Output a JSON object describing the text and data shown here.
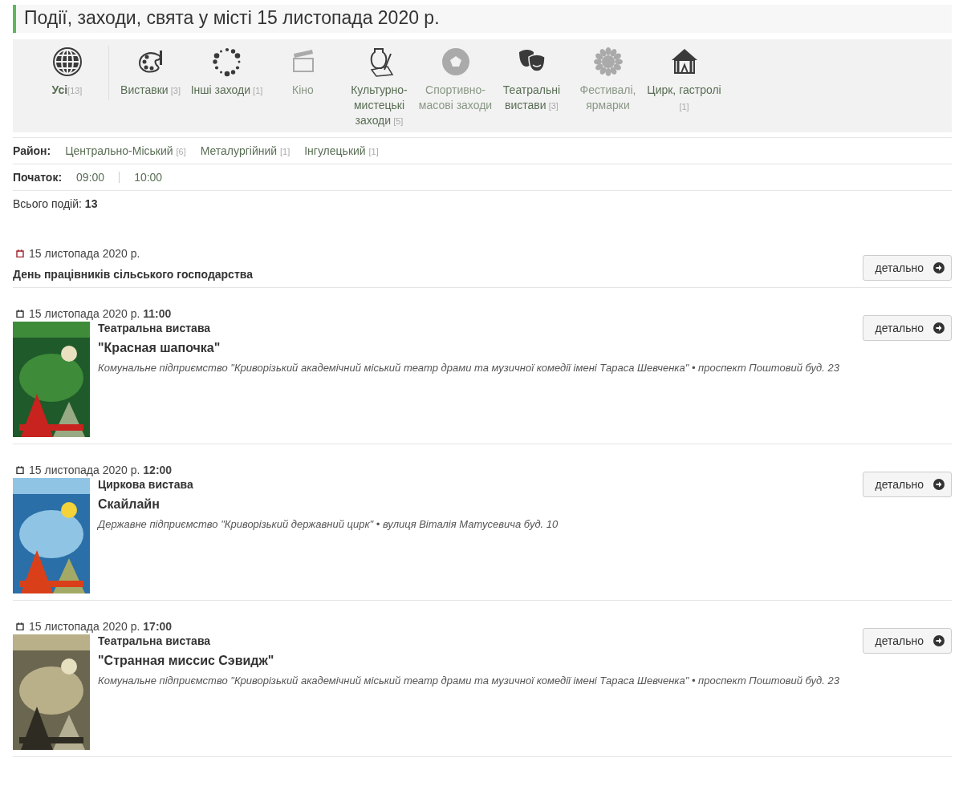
{
  "page_title": "Події, заходи, свята у місті 15 листопада 2020 р.",
  "categories": [
    {
      "kind": "globe",
      "label": "Усі",
      "count": "[13]",
      "selected": true,
      "disabled": false
    },
    {
      "kind": "palette",
      "label": "Виставки",
      "count": "[3]",
      "selected": false,
      "disabled": false
    },
    {
      "kind": "dots",
      "label": "Інші заходи",
      "count": "[1]",
      "selected": false,
      "disabled": false
    },
    {
      "kind": "clapper",
      "label": "Кіно",
      "selected": false,
      "disabled": true
    },
    {
      "kind": "vase",
      "label": "Культурно-мистецькі заходи",
      "count": "[5]",
      "selected": false,
      "disabled": false
    },
    {
      "kind": "ball",
      "label": "Спортивно-масові заходи",
      "selected": false,
      "disabled": true
    },
    {
      "kind": "masks",
      "label": "Театральні вистави",
      "count": "[3]",
      "selected": false,
      "disabled": false
    },
    {
      "kind": "flower",
      "label": "Фестивалі, ярмарки",
      "selected": false,
      "disabled": true
    },
    {
      "kind": "tent",
      "label": "Цирк, гастролі",
      "count": "[1]",
      "selected": false,
      "disabled": false
    }
  ],
  "district": {
    "label": "Район:",
    "options": [
      {
        "label": "Центрально-Міський",
        "count": "[6]"
      },
      {
        "label": "Металургійний",
        "count": "[1]"
      },
      {
        "label": "Інгулецький",
        "count": "[1]"
      }
    ]
  },
  "start": {
    "label": "Початок:",
    "options": [
      "09:00",
      "10:00"
    ]
  },
  "total": {
    "label": "Всього подій:",
    "value": "13"
  },
  "events": [
    {
      "date": "15 листопада 2020 р.",
      "title": "День працівників сільського господарства",
      "button": "детально"
    },
    {
      "date": "15 листопада 2020 р.",
      "time": "11:00",
      "type": "Театральна вистава",
      "title": "\"Красная шапочка\"",
      "place": "Комунальне підприємство \"Криворізький академічний міський театр драми та музичної комедії імені Тараса Шевченка\" • проспект Поштовий буд. 23",
      "button": "детально"
    },
    {
      "date": "15 листопада 2020 р.",
      "time": "12:00",
      "type": "Циркова вистава",
      "title": "Скайлайн",
      "place": "Державне підприємство \"Криворізький державний цирк\" • вулиця Віталія Матусевича буд. 10",
      "button": "детально"
    },
    {
      "date": "15 листопада 2020 р.",
      "time": "17:00",
      "type": "Театральна вистава",
      "title": "\"Странная миссис Сэвидж\"",
      "place": "Комунальне підприємство \"Криворізький академічний міський театр драми та музичної комедії імені Тараса Шевченка\" • проспект Поштовий буд. 23",
      "button": "детально"
    }
  ]
}
